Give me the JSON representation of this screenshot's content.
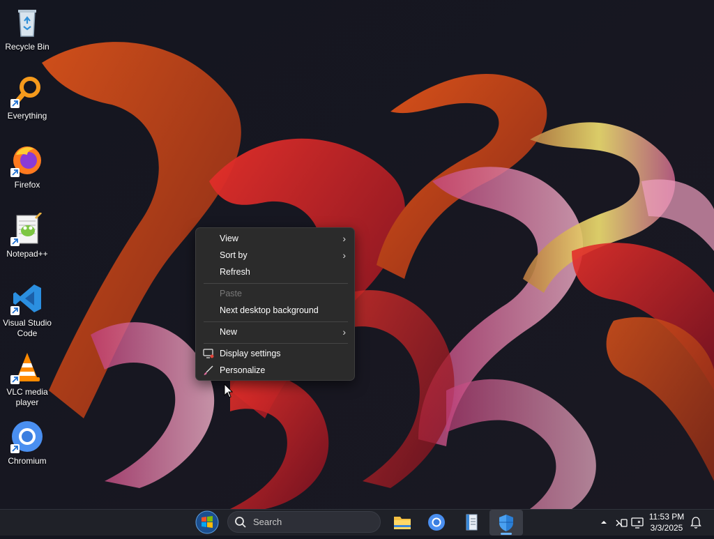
{
  "desktop": {
    "icons": [
      {
        "label": "Recycle Bin"
      },
      {
        "label": "Everything"
      },
      {
        "label": "Firefox"
      },
      {
        "label": "Notepad++"
      },
      {
        "label": "Visual Studio Code"
      },
      {
        "label": "VLC media player"
      },
      {
        "label": "Chromium"
      }
    ]
  },
  "context_menu": {
    "items": [
      {
        "label": "View",
        "submenu": true,
        "enabled": true
      },
      {
        "label": "Sort by",
        "submenu": true,
        "enabled": true
      },
      {
        "label": "Refresh",
        "submenu": false,
        "enabled": true
      },
      {
        "label": "Paste",
        "submenu": false,
        "enabled": false
      },
      {
        "label": "Next desktop background",
        "submenu": false,
        "enabled": true
      },
      {
        "label": "New",
        "submenu": true,
        "enabled": true
      },
      {
        "label": "Display settings",
        "submenu": false,
        "enabled": true,
        "icon": "display-icon"
      },
      {
        "label": "Personalize",
        "submenu": false,
        "enabled": true,
        "icon": "brush-icon"
      }
    ]
  },
  "taskbar": {
    "search_label": "Search",
    "apps": [
      "file-explorer-icon",
      "chromium-icon",
      "notepad-icon",
      "defender-icon"
    ],
    "clock": {
      "time": "11:53 PM",
      "date": "3/3/2025"
    }
  },
  "colors": {
    "menu_bg": "#2b2b2b",
    "taskbar_bg": "#1f2128",
    "accent": "#6ab4ff"
  }
}
